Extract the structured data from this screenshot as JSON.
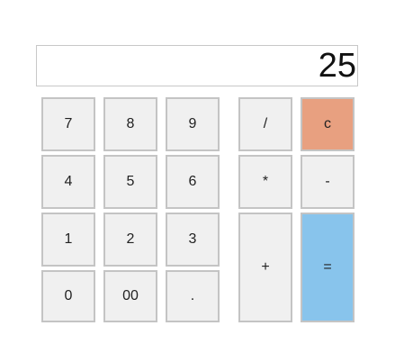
{
  "display": {
    "value": "25"
  },
  "keys": {
    "seven": "7",
    "eight": "8",
    "nine": "9",
    "four": "4",
    "five": "5",
    "six": "6",
    "one": "1",
    "two": "2",
    "three": "3",
    "zero": "0",
    "double_zero": "00",
    "decimal": ".",
    "divide": "/",
    "clear": "c",
    "multiply": "*",
    "subtract": "-",
    "add": "+",
    "equals": "="
  },
  "colors": {
    "clear_key": "#e8a080",
    "equals_key": "#88c4ec",
    "default_key": "#f0f0f0"
  }
}
